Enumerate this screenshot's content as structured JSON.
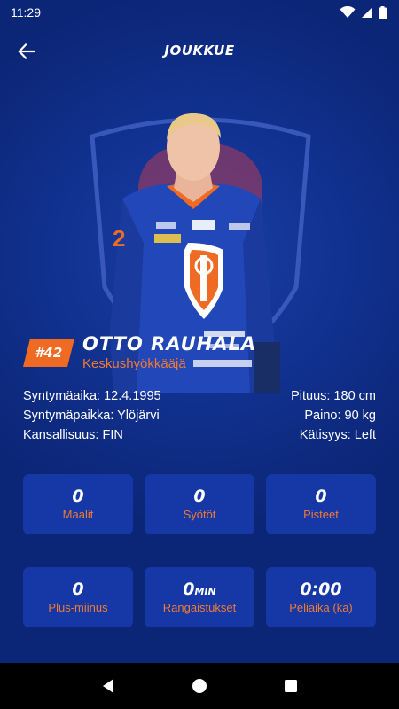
{
  "status_bar": {
    "time": "11:29"
  },
  "app_bar": {
    "title": "JOUKKUE"
  },
  "player": {
    "number": "#42",
    "name": "OTTO RAUHALA",
    "position": "Keskushyökkääjä"
  },
  "info": {
    "birthdate": "Syntymäaika: 12.4.1995",
    "height": "Pituus: 180 cm",
    "birthplace": "Syntymäpaikka: Ylöjärvi",
    "weight": "Paino: 90 kg",
    "nationality": "Kansallisuus: FIN",
    "handedness": "Kätisyys: Left"
  },
  "stats": [
    {
      "value": "0",
      "unit": "",
      "label": "Maalit"
    },
    {
      "value": "0",
      "unit": "",
      "label": "Syötöt"
    },
    {
      "value": "0",
      "unit": "",
      "label": "Pisteet"
    },
    {
      "value": "0",
      "unit": "",
      "label": "Plus-miinus"
    },
    {
      "value": "0",
      "unit": "MIN",
      "label": "Rangaistukset"
    },
    {
      "value": "0:00",
      "unit": "",
      "label": "Peliaika (ka)"
    }
  ],
  "jersey_number_visible": "2",
  "colors": {
    "background": "#0d2a82",
    "card": "#1538a6",
    "accent": "#ef6a22",
    "nav": "#000000"
  },
  "icons": {
    "back": "arrow-left-icon",
    "wifi": "wifi-icon",
    "signal": "signal-icon",
    "battery": "battery-icon",
    "nav_back": "triangle-back-icon",
    "nav_home": "circle-home-icon",
    "nav_recents": "square-recents-icon"
  }
}
